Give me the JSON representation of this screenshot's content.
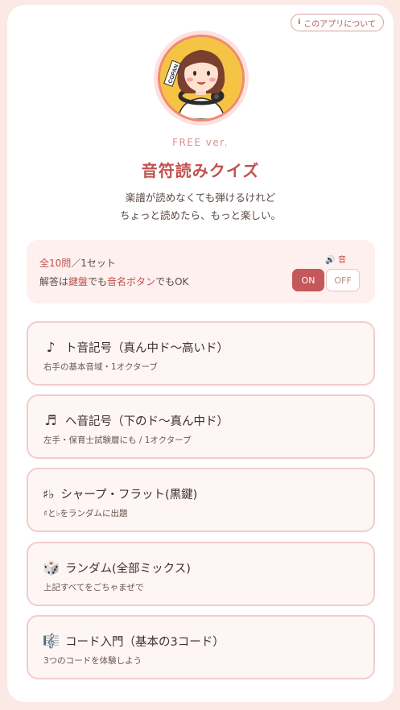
{
  "header": {
    "about_icon": "i",
    "about_label": "このアプリについて"
  },
  "avatar": {
    "badge_text": "COPAN"
  },
  "version": "FREE ver.",
  "title": "音符読みクイズ",
  "subtitle_lines": [
    "楽譜が読めなくても弾けるけれど",
    "ちょっと読めたら、もっと楽しい。"
  ],
  "info": {
    "count": "全10問",
    "set": "／1セット",
    "answer_prefix": "解答は",
    "keyboard": "鍵盤",
    "mid": "でも",
    "name_button": "音名ボタン",
    "answer_suffix": "でもOK",
    "sound_icon": "🔊",
    "sound_label": "音",
    "on_label": "ON",
    "off_label": "OFF",
    "sound_on": true
  },
  "modes": [
    {
      "icon": "♪",
      "icon_name": "eighth-note-icon",
      "title": "ト音記号（真ん中ド〜高いド）",
      "desc": "右手の基本音域・1オクターブ"
    },
    {
      "icon": "♬",
      "icon_name": "beamed-notes-icon",
      "title": "ヘ音記号（下のド〜真ん中ド）",
      "desc": "左手・保育士試験層にも / 1オクターブ"
    },
    {
      "icon": "♯♭",
      "icon_name": "sharp-flat-icon",
      "title": "シャープ・フラット(黒鍵)",
      "desc": "♯と♭をランダムに出題"
    },
    {
      "icon": "🎲",
      "icon_name": "dice-icon",
      "title": "ランダム(全部ミックス)",
      "desc": "上記すべてをごちゃまぜで"
    },
    {
      "icon": "🎼",
      "icon_name": "musical-score-icon",
      "title": "コード入門（基本の3コード）",
      "desc": "3つのコードを体験しよう"
    }
  ]
}
